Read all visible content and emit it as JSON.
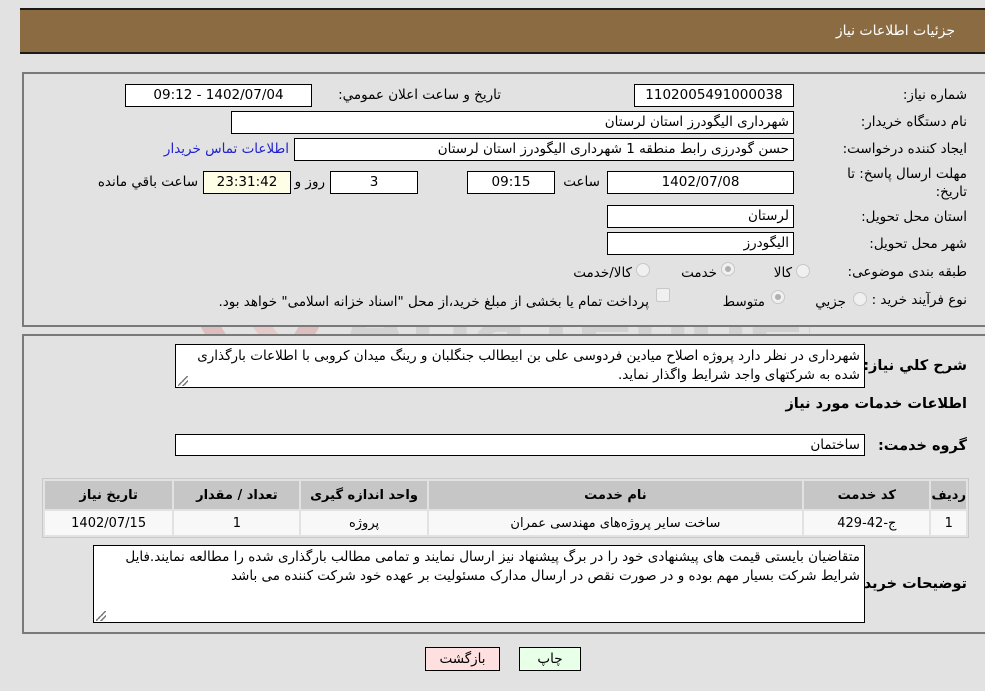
{
  "header": {
    "title": "جزئیات اطلاعات نیاز"
  },
  "details": {
    "need_number": {
      "label": "شماره نیاز:",
      "value": "1102005491000038"
    },
    "announce_datetime": {
      "label": "تاریخ و ساعت اعلان عمومي:",
      "value": "1402/07/04 - 09:12"
    },
    "buyer_org": {
      "label": "نام دستگاه خریدار:",
      "value": "شهرداری الیگودرز استان لرستان"
    },
    "requester": {
      "label": "ایجاد کننده درخواست:",
      "value": "حسن گودرزی رابط منطقه 1 شهرداری الیگودرز استان لرستان"
    },
    "buyer_contact_link": "اطلاعات تماس خریدار",
    "deadline": {
      "label": "مهلت ارسال پاسخ: تا تاریخ:",
      "date": "1402/07/08",
      "time_label": "ساعت",
      "time": "09:15",
      "days": "3",
      "days_label": "روز و",
      "remaining": "23:31:42",
      "remaining_label": "ساعت باقي مانده"
    },
    "delivery_province": {
      "label": "استان محل تحویل:",
      "value": "لرستان"
    },
    "delivery_city": {
      "label": "شهر محل تحویل:",
      "value": "الیگودرز"
    },
    "category": {
      "label": "طبقه بندی موضوعی:",
      "options": [
        "کالا",
        "خدمت",
        "کالا/خدمت"
      ],
      "selected": "خدمت"
    },
    "process_type": {
      "label": "نوع فرآیند خرید :",
      "options": [
        "جزيي",
        "متوسط"
      ],
      "selected": "متوسط",
      "treasury_note": "پرداخت تمام یا بخشی از مبلغ خرید،از محل \"اسناد خزانه اسلامی\" خواهد بود.",
      "treasury_checked": false
    }
  },
  "description": {
    "label": "شرح کلي نیاز:",
    "value": "شهرداری در نظر دارد پروژه اصلاح میادین فردوسی علی بن ابیطالب جنگلبان و رینگ میدان کروبی با اطلاعات بارگذاری شده به شرکتهای واجد شرایط واگذار نماید."
  },
  "services": {
    "section_title": "اطلاعات خدمات مورد نیاز",
    "group_label": "گروه خدمت:",
    "group_value": "ساختمان",
    "columns": [
      "ردیف",
      "کد خدمت",
      "نام خدمت",
      "واحد اندازه گیری",
      "تعداد / مقدار",
      "تاریخ نیاز"
    ],
    "rows": [
      [
        "1",
        "ج-42-429",
        "ساخت سایر پروژه‌های مهندسی عمران",
        "پروژه",
        "1",
        "1402/07/15"
      ]
    ]
  },
  "buyer_notes": {
    "label": "توضیحات خریدار:",
    "value": "متقاضیان بایستی قیمت های پیشنهادی خود را در برگ پیشنهاد نیز ارسال نمایند و تمامی مطالب بارگذاری شده را مطالعه نمایند.فایل شرایط شرکت بسیار مهم بوده و در صورت نقص در ارسال مدارک مسئولیت بر عهده خود شرکت کننده می باشد"
  },
  "buttons": {
    "print": "چاپ",
    "back": "بازگشت"
  },
  "watermark": {
    "text": "AriaTender.neT"
  }
}
